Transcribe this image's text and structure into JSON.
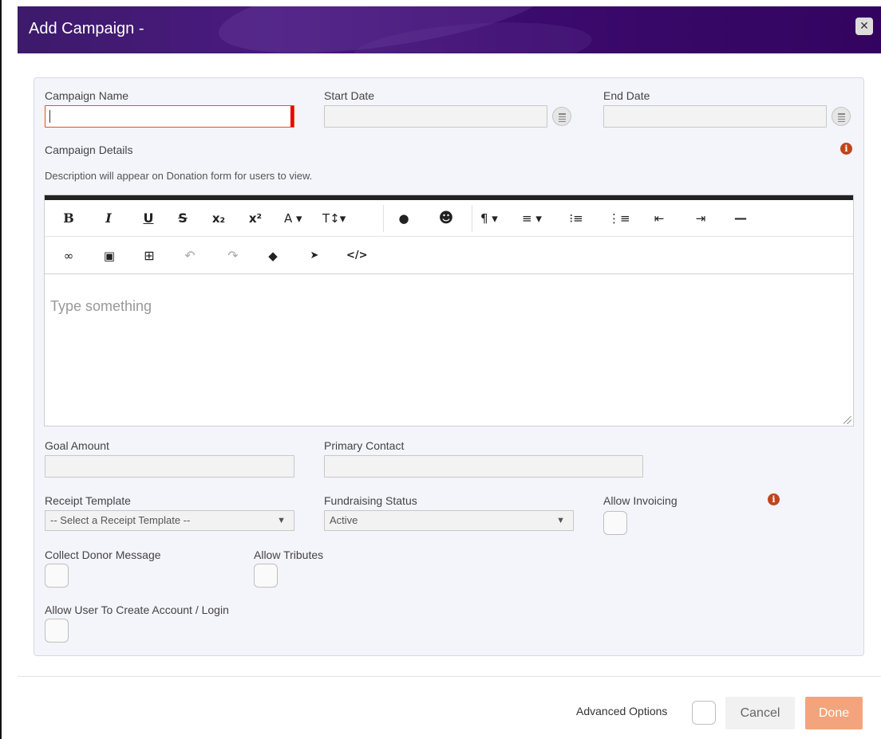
{
  "dialog": {
    "title": "Add Campaign -",
    "close_icon": "close-icon"
  },
  "fields": {
    "campaign_name": {
      "label": "Campaign Name",
      "value": ""
    },
    "start_date": {
      "label": "Start Date",
      "value": ""
    },
    "end_date": {
      "label": "End Date",
      "value": ""
    },
    "campaign_details": {
      "label": "Campaign Details",
      "help": "Description will appear on Donation form for users to view.",
      "placeholder": "Type something"
    },
    "goal_amount": {
      "label": "Goal Amount",
      "value": ""
    },
    "primary_contact": {
      "label": "Primary Contact",
      "value": ""
    },
    "receipt_template": {
      "label": "Receipt Template",
      "selected": "-- Select a Receipt Template --"
    },
    "fundraising_status": {
      "label": "Fundraising Status",
      "selected": "Active"
    },
    "allow_invoicing": {
      "label": "Allow Invoicing",
      "checked": false
    },
    "collect_donor_message": {
      "label": "Collect Donor Message",
      "checked": false
    },
    "allow_tributes": {
      "label": "Allow Tributes",
      "checked": false
    },
    "allow_user_account": {
      "label": "Allow User To Create Account / Login",
      "checked": false
    }
  },
  "toolbar": {
    "row1": [
      {
        "name": "bold-icon",
        "glyph": "B"
      },
      {
        "name": "italic-icon",
        "glyph": "I"
      },
      {
        "name": "underline-icon",
        "glyph": "U"
      },
      {
        "name": "strikethrough-icon",
        "glyph": "S"
      },
      {
        "name": "subscript-icon",
        "glyph": "x₂"
      },
      {
        "name": "superscript-icon",
        "glyph": "x²"
      },
      {
        "name": "font-color-icon",
        "glyph": "A ▾"
      },
      {
        "name": "font-size-icon",
        "glyph": "T↕▾"
      },
      {
        "name": "background-color-icon",
        "glyph": "💧"
      },
      {
        "name": "emoticon-icon",
        "glyph": "☻"
      },
      {
        "name": "paragraph-format-icon",
        "glyph": "¶ ▾"
      },
      {
        "name": "align-icon",
        "glyph": "≡ ▾"
      },
      {
        "name": "ordered-list-icon",
        "glyph": "⁝≡"
      },
      {
        "name": "unordered-list-icon",
        "glyph": "⋮≡"
      },
      {
        "name": "outdent-icon",
        "glyph": "⇤"
      },
      {
        "name": "indent-icon",
        "glyph": "⇥"
      },
      {
        "name": "horizontal-line-icon",
        "glyph": "—"
      }
    ],
    "row2": [
      {
        "name": "link-icon",
        "glyph": "🔗"
      },
      {
        "name": "image-icon",
        "glyph": "▣"
      },
      {
        "name": "table-icon",
        "glyph": "⊞"
      },
      {
        "name": "undo-icon",
        "glyph": "↶"
      },
      {
        "name": "redo-icon",
        "glyph": "↷"
      },
      {
        "name": "clear-formatting-icon",
        "glyph": "⌫"
      },
      {
        "name": "select-all-icon",
        "glyph": "➤"
      },
      {
        "name": "code-view-icon",
        "glyph": "</>"
      }
    ]
  },
  "footer": {
    "advanced_options_label": "Advanced Options",
    "cancel_label": "Cancel",
    "done_label": "Done"
  },
  "colors": {
    "header": "#3b0a6d",
    "done": "#f4a47c",
    "focus_border": "#e2541b",
    "info": "#c0451b"
  }
}
